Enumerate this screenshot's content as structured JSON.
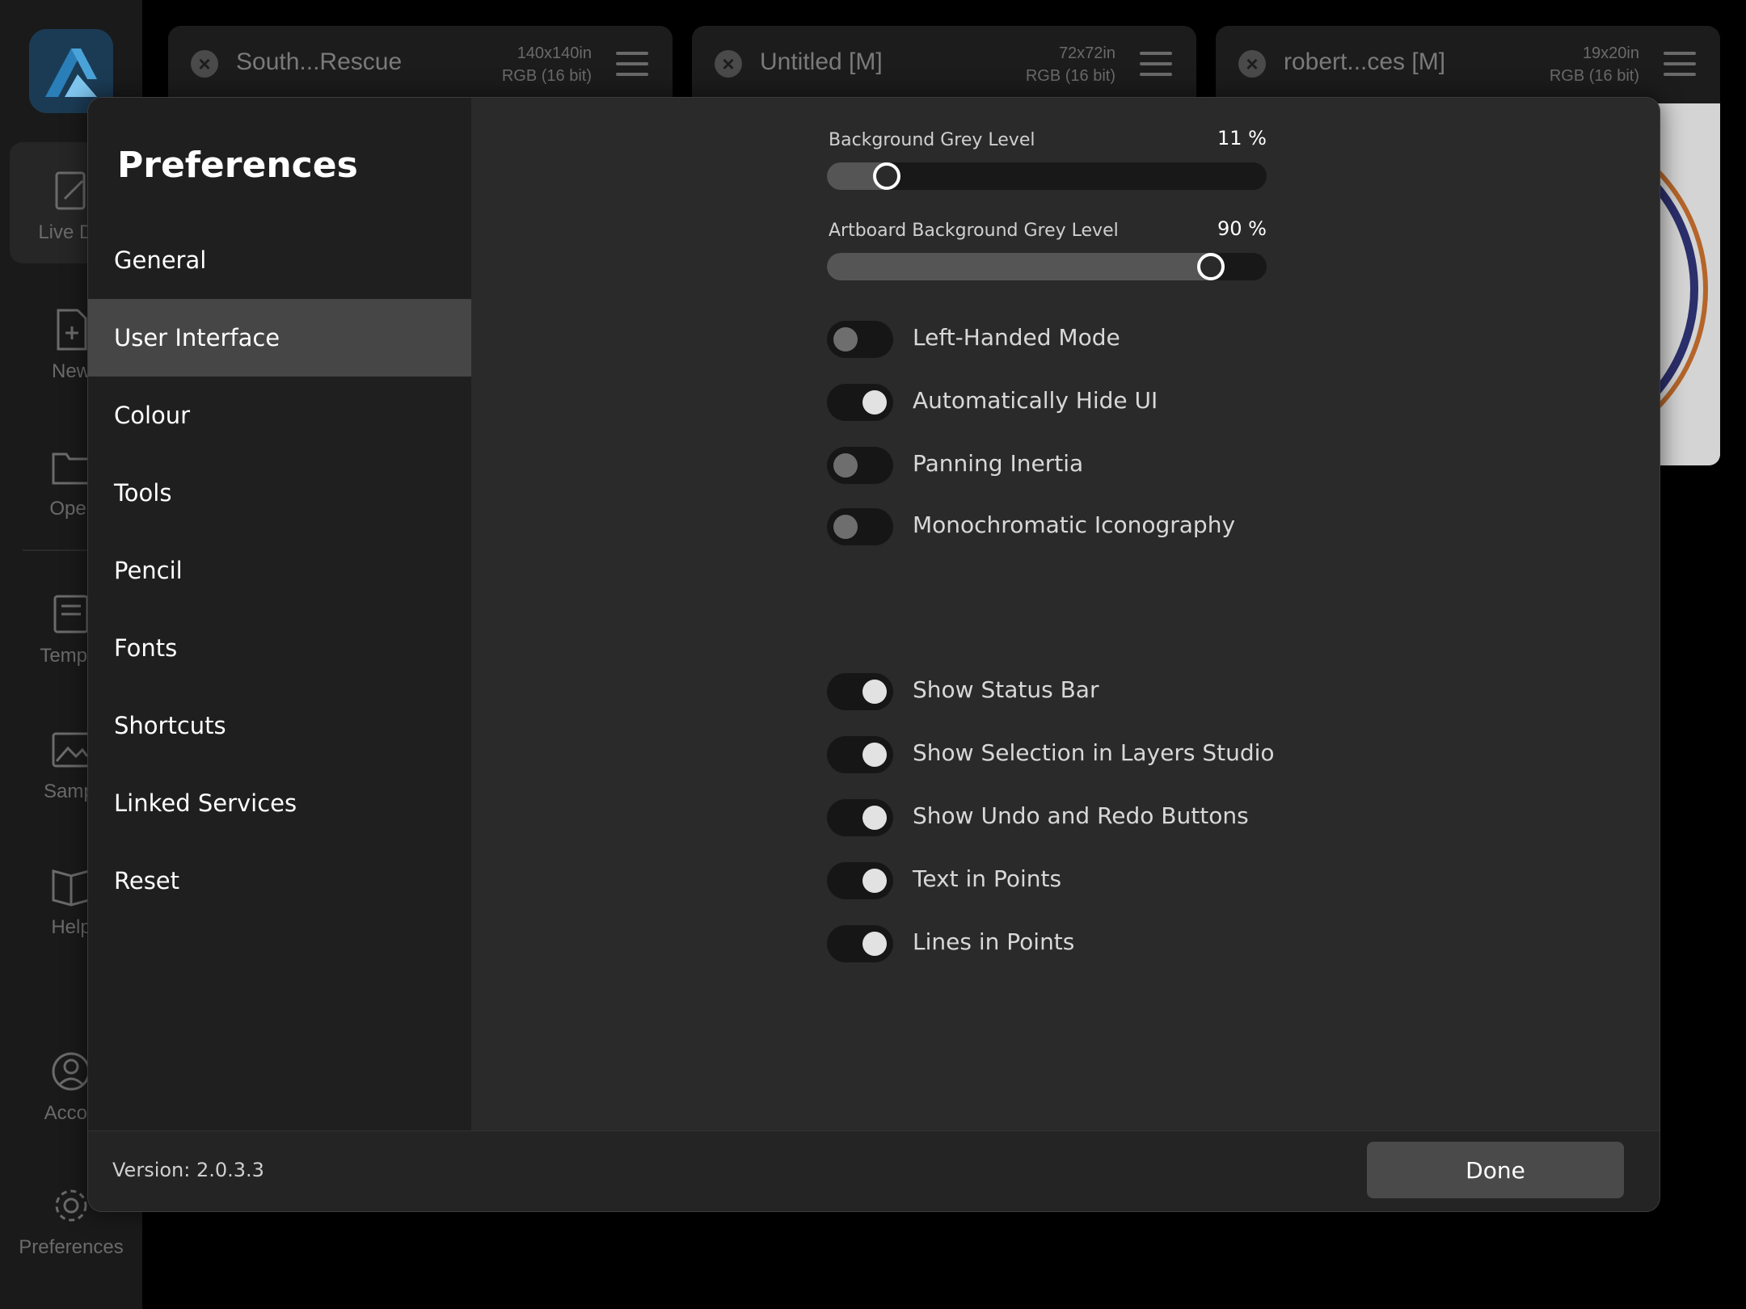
{
  "app_sidebar": {
    "items": [
      {
        "label": "Live Do",
        "icon": "live-document-icon"
      },
      {
        "label": "New",
        "icon": "new-document-icon"
      },
      {
        "label": "Oper",
        "icon": "open-folder-icon"
      },
      {
        "label": "Templa",
        "icon": "templates-icon"
      },
      {
        "label": "Sampl",
        "icon": "samples-icon"
      },
      {
        "label": "Help",
        "icon": "help-book-icon"
      },
      {
        "label": "Accou",
        "icon": "account-icon"
      },
      {
        "label": "Preferences",
        "icon": "gear-icon"
      }
    ]
  },
  "doc_tabs": [
    {
      "title": "South...Rescue",
      "size": "140x140in",
      "mode": "RGB (16 bit)"
    },
    {
      "title": "Untitled [M]",
      "size": "72x72in",
      "mode": "RGB (16 bit)"
    },
    {
      "title": "robert...ces [M]",
      "size": "19x20in",
      "mode": "RGB (16 bit)"
    }
  ],
  "prefs": {
    "title": "Preferences",
    "nav": [
      "General",
      "User Interface",
      "Colour",
      "Tools",
      "Pencil",
      "Fonts",
      "Shortcuts",
      "Linked Services",
      "Reset"
    ],
    "active_nav": "User Interface",
    "sliders": {
      "background_grey": {
        "label": "Background Grey Level",
        "value": 11,
        "display": "11 %"
      },
      "artboard_grey": {
        "label": "Artboard Background Grey Level",
        "value": 90,
        "display": "90 %"
      }
    },
    "toggles": [
      {
        "label": "Left-Handed Mode",
        "on": false
      },
      {
        "label": "Automatically Hide UI",
        "on": true
      },
      {
        "label": "Panning Inertia",
        "on": false
      },
      {
        "label": "Monochromatic Iconography",
        "on": false
      },
      {
        "label": "Show Status Bar",
        "on": true
      },
      {
        "label": "Show Selection in Layers Studio",
        "on": true
      },
      {
        "label": "Show Undo and Redo Buttons",
        "on": true
      },
      {
        "label": "Text in Points",
        "on": true
      },
      {
        "label": "Lines in Points",
        "on": true
      }
    ],
    "version": "Version: 2.0.3.3",
    "done_label": "Done"
  },
  "colors": {
    "accent_logo": "#2a7fb8",
    "toggle_on_knob": "#e2e2e2",
    "toggle_off_knob": "#6e6e6e",
    "active_nav_bg": "#464646"
  }
}
